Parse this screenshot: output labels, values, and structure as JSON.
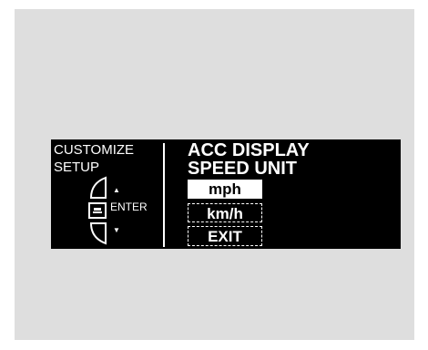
{
  "display": {
    "left_title_line1": "CUSTOMIZE",
    "left_title_line2": "SETUP",
    "enter_label": "ENTER",
    "menu_title_line1": "ACC DISPLAY",
    "menu_title_line2": "SPEED UNIT",
    "options": [
      {
        "label": "mph",
        "selected": true
      },
      {
        "label": "km/h",
        "selected": false
      },
      {
        "label": "EXIT",
        "selected": false
      }
    ]
  },
  "colors": {
    "panel_background": "#dedede",
    "screen_background": "#000000",
    "screen_text": "#ffffff"
  },
  "icons": {
    "up_arrow": "up-triangle-icon",
    "down_arrow": "down-triangle-icon",
    "selector": "selector-dial-icon",
    "enter": "enter-button-icon"
  }
}
